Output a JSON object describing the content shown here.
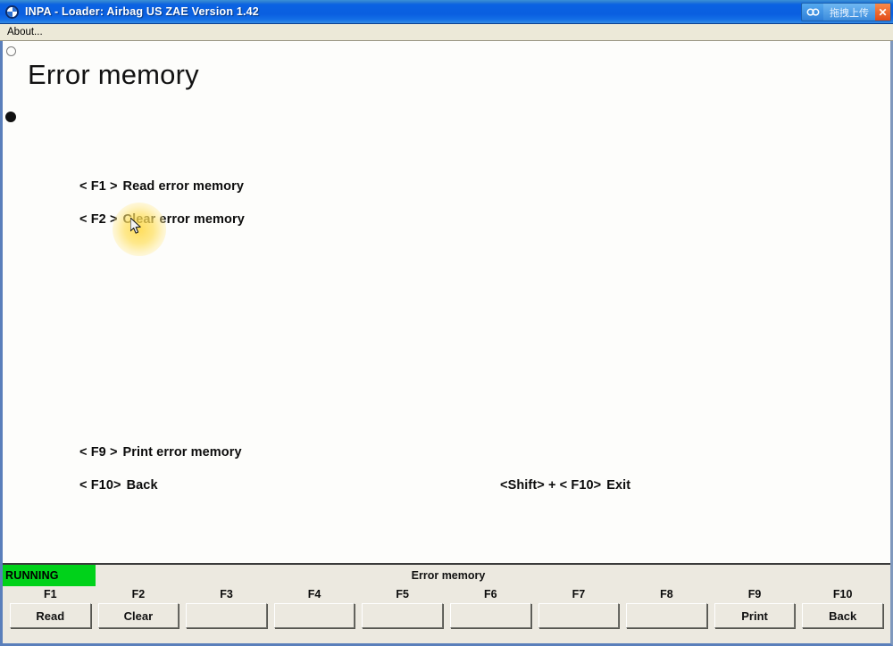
{
  "window": {
    "title": "INPA - Loader:  Airbag US ZAE Version 1.42",
    "logo_icon": "bmw-roundel-icon"
  },
  "upload_widget": {
    "cloud_icon": "cloud-upload-icon",
    "label": "拖拽上传",
    "close_label": "✕"
  },
  "menubar": {
    "items": [
      {
        "label": "About..."
      }
    ]
  },
  "canvas": {
    "title": "Error memory",
    "marker_circle_icon": "hollow-circle-marker-icon",
    "marker_dot_icon": "filled-dot-marker-icon",
    "cursor_icon": "arrow-cursor-icon",
    "click_highlight_color": "#ffd840",
    "options": [
      {
        "key": "< F1 >",
        "label": "Read error memory"
      },
      {
        "key": "< F2 >",
        "label": "Clear error memory"
      },
      {
        "key": "< F9 >",
        "label": "Print error memory"
      },
      {
        "key": "< F10>",
        "label": "Back"
      },
      {
        "key": "<Shift> + < F10>",
        "label": "Exit"
      }
    ]
  },
  "statusbar": {
    "state": "RUNNING",
    "state_color": "#00d21a",
    "screen_name": "Error memory",
    "fkeys": [
      {
        "key": "F1",
        "label": "Read"
      },
      {
        "key": "F2",
        "label": "Clear"
      },
      {
        "key": "F3",
        "label": ""
      },
      {
        "key": "F4",
        "label": ""
      },
      {
        "key": "F5",
        "label": ""
      },
      {
        "key": "F6",
        "label": ""
      },
      {
        "key": "F7",
        "label": ""
      },
      {
        "key": "F8",
        "label": ""
      },
      {
        "key": "F9",
        "label": "Print"
      },
      {
        "key": "F10",
        "label": "Back"
      }
    ]
  }
}
